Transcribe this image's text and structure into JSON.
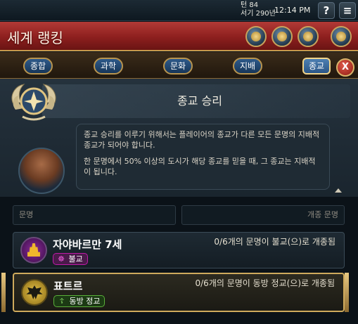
{
  "topbar": {
    "turn": "턴 84",
    "year": "서기 290년",
    "time": "12:14 PM",
    "help_label": "?",
    "menu_label": "≡"
  },
  "header": {
    "title": "세계 랭킹",
    "icons": [
      "globe-icon",
      "bell-icon",
      "refresh-icon",
      "scroll-icon"
    ]
  },
  "tabs": [
    {
      "label": "종합",
      "active": false
    },
    {
      "label": "과학",
      "active": false
    },
    {
      "label": "문화",
      "active": false
    },
    {
      "label": "지배",
      "active": false
    },
    {
      "label": "종교",
      "active": true
    }
  ],
  "close_label": "X",
  "victory": {
    "title": "종교 승리",
    "paragraphs": [
      "종교 승리를 이루기 위해서는 플레이어의 종교가 다른 모든 문명의 지배적 종교가 되어야 합니다.",
      "한 문명에서 50% 이상의 도시가 해당 종교를 믿을 때, 그 종교는 지배적이 됩니다."
    ]
  },
  "columns": {
    "civ": "문명",
    "converted": "개종 문명"
  },
  "rows": [
    {
      "name": "자야바르만 7세",
      "religion": "불교",
      "religion_icon": "dharma-wheel-icon",
      "religion_color": "#c01aa8",
      "status": "0/6개의 문명이 불교(으)로 개종됨",
      "civ_color": "#5a1a6a"
    },
    {
      "name": "표트르",
      "religion": "동방 정교",
      "religion_icon": "orthodox-cross-icon",
      "religion_color": "#3f8f2a",
      "status": "0/6개의 문명이 동방 정교(으)로 개종됨",
      "civ_color": "#d8b43a"
    }
  ]
}
